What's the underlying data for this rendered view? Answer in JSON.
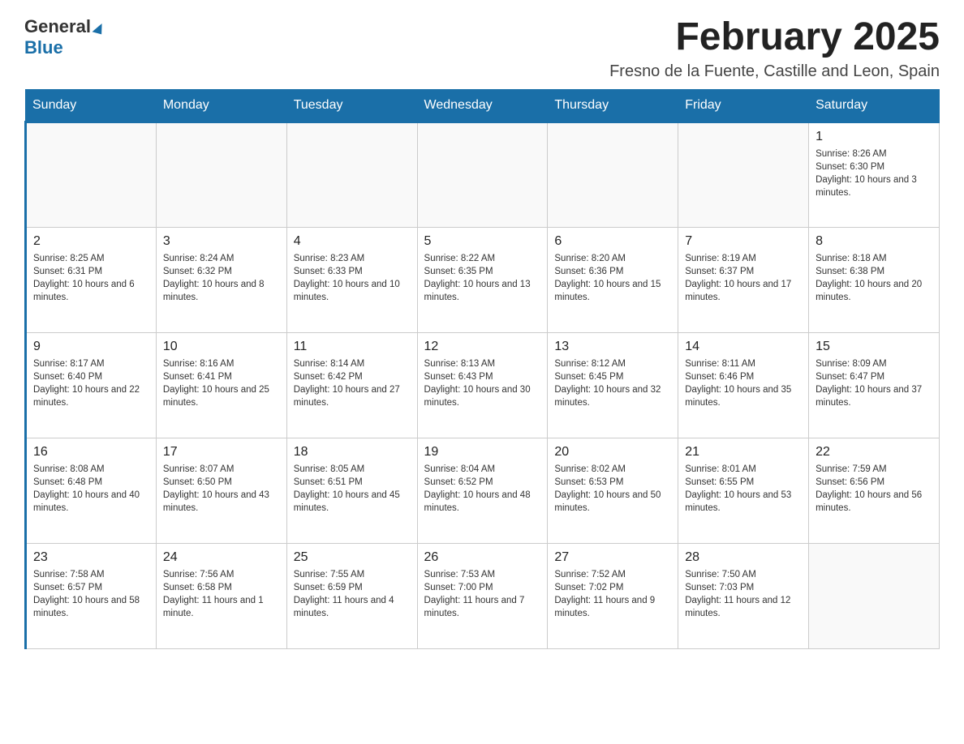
{
  "logo": {
    "text_general": "General",
    "text_blue": "Blue"
  },
  "header": {
    "title": "February 2025",
    "subtitle": "Fresno de la Fuente, Castille and Leon, Spain"
  },
  "days_of_week": [
    "Sunday",
    "Monday",
    "Tuesday",
    "Wednesday",
    "Thursday",
    "Friday",
    "Saturday"
  ],
  "weeks": [
    [
      {
        "day": "",
        "info": ""
      },
      {
        "day": "",
        "info": ""
      },
      {
        "day": "",
        "info": ""
      },
      {
        "day": "",
        "info": ""
      },
      {
        "day": "",
        "info": ""
      },
      {
        "day": "",
        "info": ""
      },
      {
        "day": "1",
        "info": "Sunrise: 8:26 AM\nSunset: 6:30 PM\nDaylight: 10 hours and 3 minutes."
      }
    ],
    [
      {
        "day": "2",
        "info": "Sunrise: 8:25 AM\nSunset: 6:31 PM\nDaylight: 10 hours and 6 minutes."
      },
      {
        "day": "3",
        "info": "Sunrise: 8:24 AM\nSunset: 6:32 PM\nDaylight: 10 hours and 8 minutes."
      },
      {
        "day": "4",
        "info": "Sunrise: 8:23 AM\nSunset: 6:33 PM\nDaylight: 10 hours and 10 minutes."
      },
      {
        "day": "5",
        "info": "Sunrise: 8:22 AM\nSunset: 6:35 PM\nDaylight: 10 hours and 13 minutes."
      },
      {
        "day": "6",
        "info": "Sunrise: 8:20 AM\nSunset: 6:36 PM\nDaylight: 10 hours and 15 minutes."
      },
      {
        "day": "7",
        "info": "Sunrise: 8:19 AM\nSunset: 6:37 PM\nDaylight: 10 hours and 17 minutes."
      },
      {
        "day": "8",
        "info": "Sunrise: 8:18 AM\nSunset: 6:38 PM\nDaylight: 10 hours and 20 minutes."
      }
    ],
    [
      {
        "day": "9",
        "info": "Sunrise: 8:17 AM\nSunset: 6:40 PM\nDaylight: 10 hours and 22 minutes."
      },
      {
        "day": "10",
        "info": "Sunrise: 8:16 AM\nSunset: 6:41 PM\nDaylight: 10 hours and 25 minutes."
      },
      {
        "day": "11",
        "info": "Sunrise: 8:14 AM\nSunset: 6:42 PM\nDaylight: 10 hours and 27 minutes."
      },
      {
        "day": "12",
        "info": "Sunrise: 8:13 AM\nSunset: 6:43 PM\nDaylight: 10 hours and 30 minutes."
      },
      {
        "day": "13",
        "info": "Sunrise: 8:12 AM\nSunset: 6:45 PM\nDaylight: 10 hours and 32 minutes."
      },
      {
        "day": "14",
        "info": "Sunrise: 8:11 AM\nSunset: 6:46 PM\nDaylight: 10 hours and 35 minutes."
      },
      {
        "day": "15",
        "info": "Sunrise: 8:09 AM\nSunset: 6:47 PM\nDaylight: 10 hours and 37 minutes."
      }
    ],
    [
      {
        "day": "16",
        "info": "Sunrise: 8:08 AM\nSunset: 6:48 PM\nDaylight: 10 hours and 40 minutes."
      },
      {
        "day": "17",
        "info": "Sunrise: 8:07 AM\nSunset: 6:50 PM\nDaylight: 10 hours and 43 minutes."
      },
      {
        "day": "18",
        "info": "Sunrise: 8:05 AM\nSunset: 6:51 PM\nDaylight: 10 hours and 45 minutes."
      },
      {
        "day": "19",
        "info": "Sunrise: 8:04 AM\nSunset: 6:52 PM\nDaylight: 10 hours and 48 minutes."
      },
      {
        "day": "20",
        "info": "Sunrise: 8:02 AM\nSunset: 6:53 PM\nDaylight: 10 hours and 50 minutes."
      },
      {
        "day": "21",
        "info": "Sunrise: 8:01 AM\nSunset: 6:55 PM\nDaylight: 10 hours and 53 minutes."
      },
      {
        "day": "22",
        "info": "Sunrise: 7:59 AM\nSunset: 6:56 PM\nDaylight: 10 hours and 56 minutes."
      }
    ],
    [
      {
        "day": "23",
        "info": "Sunrise: 7:58 AM\nSunset: 6:57 PM\nDaylight: 10 hours and 58 minutes."
      },
      {
        "day": "24",
        "info": "Sunrise: 7:56 AM\nSunset: 6:58 PM\nDaylight: 11 hours and 1 minute."
      },
      {
        "day": "25",
        "info": "Sunrise: 7:55 AM\nSunset: 6:59 PM\nDaylight: 11 hours and 4 minutes."
      },
      {
        "day": "26",
        "info": "Sunrise: 7:53 AM\nSunset: 7:00 PM\nDaylight: 11 hours and 7 minutes."
      },
      {
        "day": "27",
        "info": "Sunrise: 7:52 AM\nSunset: 7:02 PM\nDaylight: 11 hours and 9 minutes."
      },
      {
        "day": "28",
        "info": "Sunrise: 7:50 AM\nSunset: 7:03 PM\nDaylight: 11 hours and 12 minutes."
      },
      {
        "day": "",
        "info": ""
      }
    ]
  ]
}
